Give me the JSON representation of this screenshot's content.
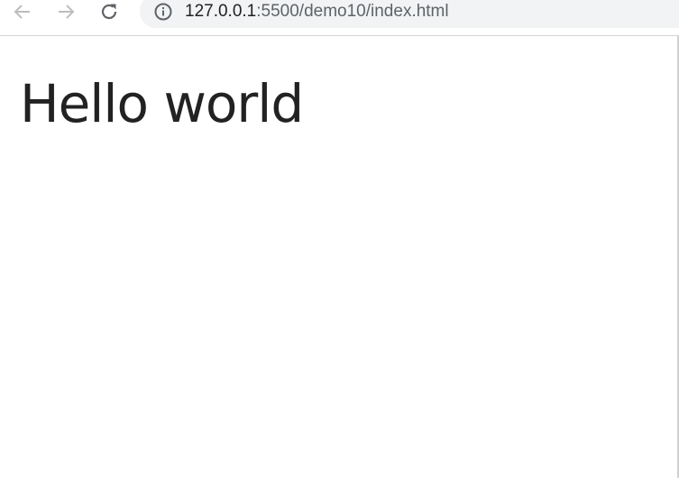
{
  "browser": {
    "address_bar": {
      "url_host": "127.0.0.1",
      "url_rest": ":5500/demo10/index.html"
    },
    "icons": {
      "back": "arrow-left-icon",
      "forward": "arrow-right-icon",
      "reload": "reload-icon",
      "site_info": "info-icon"
    },
    "colors": {
      "toolbar_bg": "#ffffff",
      "omnibox_bg": "#f1f3f4",
      "icon_disabled": "#bdbdbd",
      "icon_active": "#5f6368"
    }
  },
  "page": {
    "heading": "Hello world"
  }
}
